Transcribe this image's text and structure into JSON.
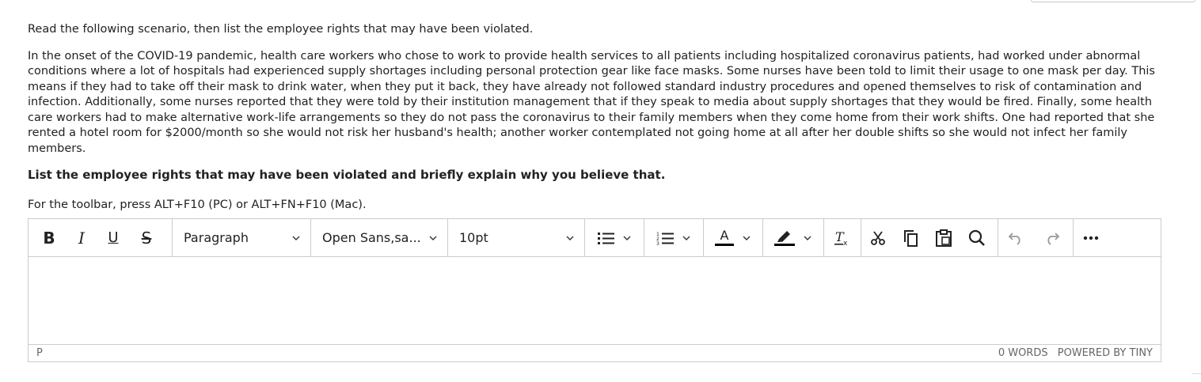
{
  "question": {
    "intro": "Read the following scenario, then list the employee rights that may have been violated.",
    "scenario": "In the onset of the COVID-19 pandemic, health care workers who chose to work to provide health services to all patients including hospitalized coronavirus patients, had worked under abnormal conditions where a lot of hospitals had experienced supply shortages including personal protection gear like face masks. Some nurses have been told to limit their usage to one mask per day. This means if they had to take off their mask to drink water, when they put it back, they have already not followed standard industry procedures and opened themselves to risk of contamination and infection. Additionally, some nurses reported that they were told by their institution management that if they speak to media about supply shortages that they would be fired. Finally, some health care workers had to make alternative work-life arrangements so they do not pass the coronavirus to their family members when they come home from their work shifts. One had reported that she rented a hotel room for $2000/month so she would not risk her husband's health; another worker contemplated not going home at all after her double shifts so she would not infect her family members.",
    "prompt": "List the employee rights that may have been violated and briefly explain why you believe that.",
    "toolbar_hint": "For the toolbar, press ALT+F10 (PC) or ALT+FN+F10 (Mac)."
  },
  "toolbar": {
    "bold": "B",
    "italic": "I",
    "underline": "U",
    "strikethrough": "S",
    "block_format": "Paragraph",
    "font_family": "Open Sans,sa...",
    "font_size": "10pt",
    "text_color_letter": "A"
  },
  "colors": {
    "text_color_bar": "#000000",
    "highlight_bar": "#000000",
    "border": "#cccccc"
  },
  "statusbar": {
    "path": "P",
    "word_count": "0 WORDS",
    "branding": "POWERED BY TINY"
  }
}
